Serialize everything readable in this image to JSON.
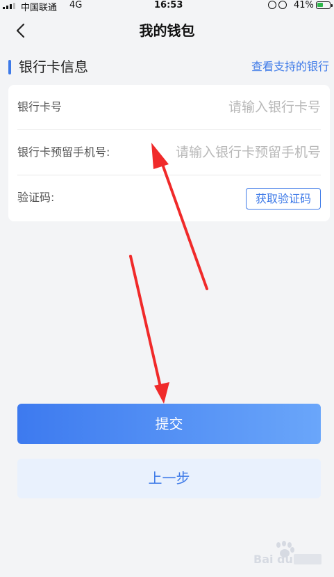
{
  "status_bar": {
    "carrier": "中国联通",
    "network": "4G",
    "time": "16:53",
    "battery": "41%"
  },
  "nav": {
    "back_icon": "chevron-left-icon",
    "title": "我的钱包"
  },
  "section": {
    "title": "银行卡信息",
    "link": "查看支持的银行"
  },
  "form": {
    "card_number": {
      "label": "银行卡号",
      "placeholder": "请输入银行卡号",
      "value": ""
    },
    "phone": {
      "label": "银行卡预留手机号:",
      "placeholder": "请输入银行卡预留手机号",
      "value": ""
    },
    "code": {
      "label": "验证码:",
      "button": "获取验证码"
    }
  },
  "actions": {
    "submit": "提交",
    "previous": "上一步"
  },
  "colors": {
    "accent": "#3e7ae8",
    "annotation": "#f02a2a"
  }
}
